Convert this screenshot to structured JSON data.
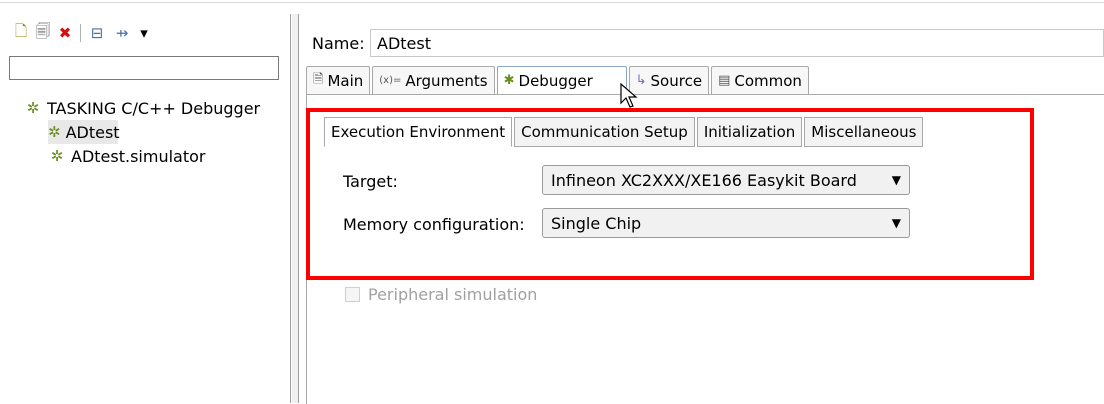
{
  "left": {
    "toolbar_icons": [
      {
        "name": "new-config-icon",
        "glyph": "🗋"
      },
      {
        "name": "duplicate-icon",
        "glyph": "🗐"
      },
      {
        "name": "delete-icon",
        "glyph": "✖"
      },
      {
        "name": "collapse-all-icon",
        "glyph": "⊟"
      },
      {
        "name": "filter-icon",
        "glyph": "⇸"
      },
      {
        "name": "view-menu-icon",
        "glyph": "▾"
      }
    ],
    "filter_value": "",
    "tree": {
      "root": "TASKING C/C++ Debugger",
      "children": [
        "ADtest",
        "ADtest.simulator"
      ]
    }
  },
  "right": {
    "name_label": "Name:",
    "name_value": "ADtest",
    "outer_tabs": [
      {
        "label": "Main",
        "icon": "🗎"
      },
      {
        "label": "Arguments",
        "icon": "(x)="
      },
      {
        "label": "Debugger",
        "icon": "✱"
      },
      {
        "label": "Source",
        "icon": "↳"
      },
      {
        "label": "Common",
        "icon": "▤"
      }
    ],
    "inner_tabs": [
      "Execution Environment",
      "Communication Setup",
      "Initialization",
      "Miscellaneous"
    ],
    "target_label": "Target:",
    "target_value": "Infineon XC2XXX/XE166 Easykit Board",
    "memory_label": "Memory configuration:",
    "memory_value": "Single Chip",
    "peripheral_label": "Peripheral simulation"
  },
  "colors": {
    "highlight": "#ff0000",
    "tree_icon": "#6b8e23"
  }
}
